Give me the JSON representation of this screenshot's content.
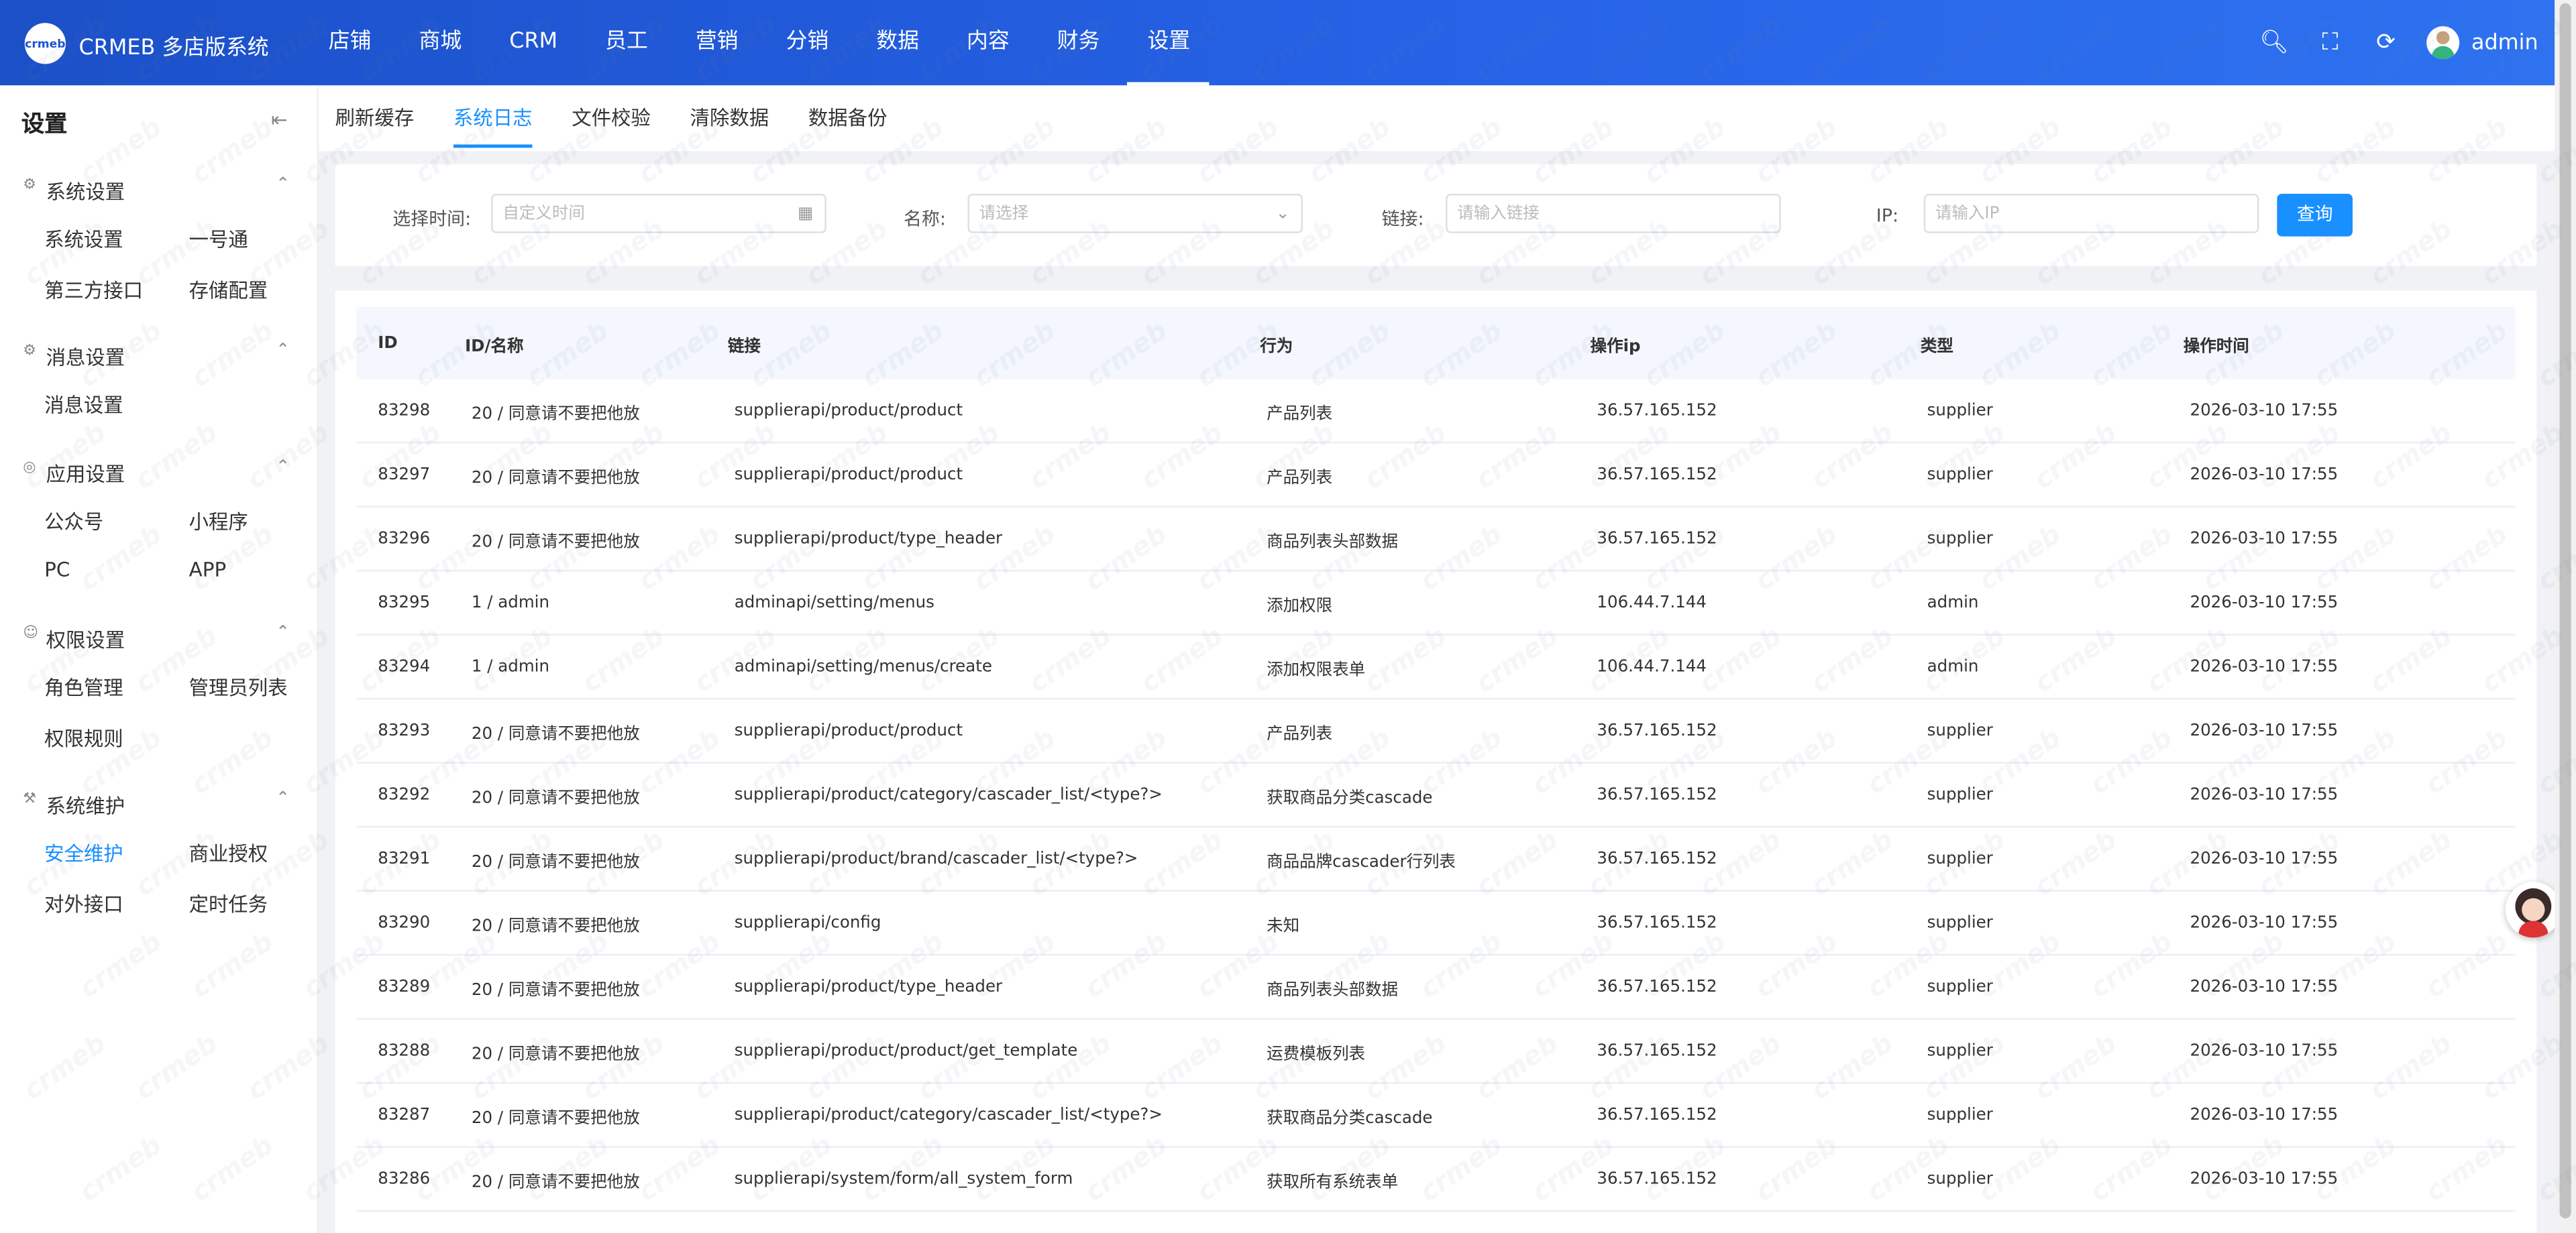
{
  "brand": {
    "logo_text": "crmeb",
    "title": "CRMEB 多店版系统"
  },
  "topnav": [
    {
      "label": "店铺"
    },
    {
      "label": "商城"
    },
    {
      "label": "CRM"
    },
    {
      "label": "员工"
    },
    {
      "label": "营销"
    },
    {
      "label": "分销"
    },
    {
      "label": "数据"
    },
    {
      "label": "内容"
    },
    {
      "label": "财务"
    },
    {
      "label": "设置",
      "active": true
    }
  ],
  "user": {
    "name": "admin"
  },
  "sidebar": {
    "title": "设置",
    "groups": [
      {
        "label": "系统设置",
        "items": [
          "系统设置",
          "一号通",
          "第三方接口",
          "存储配置"
        ]
      },
      {
        "label": "消息设置",
        "items": [
          "消息设置"
        ]
      },
      {
        "label": "应用设置",
        "items": [
          "公众号",
          "小程序",
          "PC",
          "APP"
        ]
      },
      {
        "label": "权限设置",
        "items": [
          "角色管理",
          "管理员列表",
          "权限规则"
        ]
      },
      {
        "label": "系统维护",
        "items": [
          "安全维护",
          "商业授权",
          "对外接口",
          "定时任务"
        ]
      }
    ],
    "active_item": "安全维护"
  },
  "tabs": [
    {
      "label": "刷新缓存"
    },
    {
      "label": "系统日志",
      "active": true
    },
    {
      "label": "文件校验"
    },
    {
      "label": "清除数据"
    },
    {
      "label": "数据备份"
    }
  ],
  "filters": {
    "time_label": "选择时间:",
    "time_placeholder": "自定义时间",
    "name_label": "名称:",
    "name_placeholder": "请选择",
    "link_label": "链接:",
    "link_placeholder": "请输入链接",
    "ip_label": "IP:",
    "ip_placeholder": "请输入IP",
    "query_label": "查询"
  },
  "table": {
    "columns": [
      "ID",
      "ID/名称",
      "链接",
      "行为",
      "操作ip",
      "类型",
      "操作时间"
    ],
    "rows": [
      [
        "83298",
        "20 / 同意请不要把他放",
        "supplierapi/product/product",
        "产品列表",
        "36.57.165.152",
        "supplier",
        "2026-03-10 17:55"
      ],
      [
        "83297",
        "20 / 同意请不要把他放",
        "supplierapi/product/product",
        "产品列表",
        "36.57.165.152",
        "supplier",
        "2026-03-10 17:55"
      ],
      [
        "83296",
        "20 / 同意请不要把他放",
        "supplierapi/product/type_header",
        "商品列表头部数据",
        "36.57.165.152",
        "supplier",
        "2026-03-10 17:55"
      ],
      [
        "83295",
        "1 / admin",
        "adminapi/setting/menus",
        "添加权限",
        "106.44.7.144",
        "admin",
        "2026-03-10 17:55"
      ],
      [
        "83294",
        "1 / admin",
        "adminapi/setting/menus/create",
        "添加权限表单",
        "106.44.7.144",
        "admin",
        "2026-03-10 17:55"
      ],
      [
        "83293",
        "20 / 同意请不要把他放",
        "supplierapi/product/product",
        "产品列表",
        "36.57.165.152",
        "supplier",
        "2026-03-10 17:55"
      ],
      [
        "83292",
        "20 / 同意请不要把他放",
        "supplierapi/product/category/cascader_list/<type?>",
        "获取商品分类cascade",
        "36.57.165.152",
        "supplier",
        "2026-03-10 17:55"
      ],
      [
        "83291",
        "20 / 同意请不要把他放",
        "supplierapi/product/brand/cascader_list/<type?>",
        "商品品牌cascader行列表",
        "36.57.165.152",
        "supplier",
        "2026-03-10 17:55"
      ],
      [
        "83290",
        "20 / 同意请不要把他放",
        "supplierapi/config",
        "未知",
        "36.57.165.152",
        "supplier",
        "2026-03-10 17:55"
      ],
      [
        "83289",
        "20 / 同意请不要把他放",
        "supplierapi/product/type_header",
        "商品列表头部数据",
        "36.57.165.152",
        "supplier",
        "2026-03-10 17:55"
      ],
      [
        "83288",
        "20 / 同意请不要把他放",
        "supplierapi/product/product/get_template",
        "运费模板列表",
        "36.57.165.152",
        "supplier",
        "2026-03-10 17:55"
      ],
      [
        "83287",
        "20 / 同意请不要把他放",
        "supplierapi/product/category/cascader_list/<type?>",
        "获取商品分类cascade",
        "36.57.165.152",
        "supplier",
        "2026-03-10 17:55"
      ],
      [
        "83286",
        "20 / 同意请不要把他放",
        "supplierapi/system/form/all_system_form",
        "获取所有系统表单",
        "36.57.165.152",
        "supplier",
        "2026-03-10 17:55"
      ]
    ]
  },
  "watermark_text": "crmeb",
  "colors": {
    "topbar_start": "#1b50c8",
    "topbar_end": "#2e72f0",
    "accent": "#1890ff"
  }
}
